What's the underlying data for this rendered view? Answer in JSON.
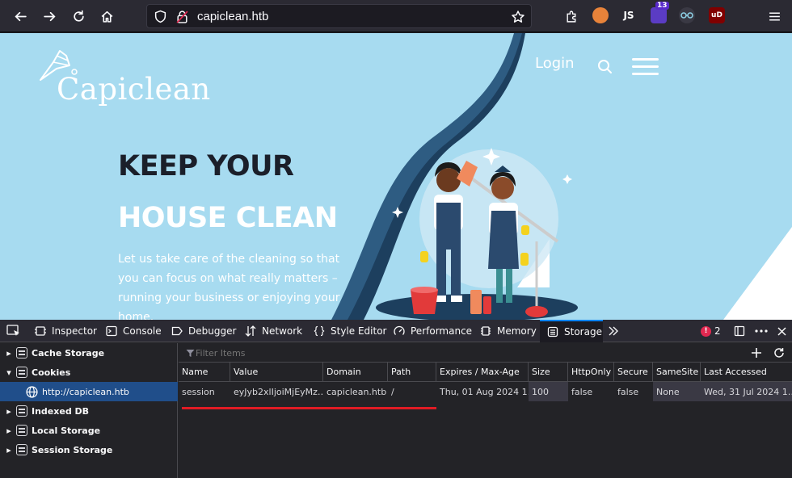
{
  "browser": {
    "url": "capiclean.htb",
    "extensions": [
      {
        "icon": "fox-ext-icon",
        "badge": ""
      },
      {
        "icon": "js-ext-icon",
        "label": "JS"
      },
      {
        "icon": "purple-ext-icon",
        "badge": "13"
      },
      {
        "icon": "spy-ext-icon",
        "badge": ""
      },
      {
        "icon": "ublock-icon",
        "label": "uD"
      }
    ]
  },
  "page": {
    "logo": "Capiclean",
    "nav": {
      "login": "Login"
    },
    "hero": {
      "line1": "KEEP YOUR",
      "line2": "HOUSE CLEAN",
      "paragraph": "Let us take care of the cleaning so that you can focus on what really matters – running your business or enjoying your home."
    },
    "colors": {
      "bg": "#a7dbf0",
      "dark_wave": "#1d3f5e",
      "light_wave": "#ffffff"
    }
  },
  "devtools": {
    "tabs": [
      "Inspector",
      "Console",
      "Debugger",
      "Network",
      "Style Editor",
      "Performance",
      "Memory",
      "Storage"
    ],
    "active_tab": "Storage",
    "error_count": "2",
    "sidebar": [
      {
        "label": "Cache Storage",
        "expanded": false
      },
      {
        "label": "Cookies",
        "expanded": true
      },
      {
        "label": "http://capiclean.htb",
        "child": true
      },
      {
        "label": "Indexed DB",
        "expanded": false
      },
      {
        "label": "Local Storage",
        "expanded": false
      },
      {
        "label": "Session Storage",
        "expanded": false
      }
    ],
    "filter_placeholder": "Filter Items",
    "table": {
      "columns": [
        "Name",
        "Value",
        "Domain",
        "Path",
        "Expires / Max-Age",
        "Size",
        "HttpOnly",
        "Secure",
        "SameSite",
        "Last Accessed"
      ],
      "rows": [
        [
          "session",
          "eyJyb2xlIjoiMjEyMz…",
          "capiclean.htb",
          "/",
          "Thu, 01 Aug 2024 1…",
          "100",
          "false",
          "false",
          "None",
          "Wed, 31 Jul 2024 1…"
        ]
      ]
    }
  }
}
